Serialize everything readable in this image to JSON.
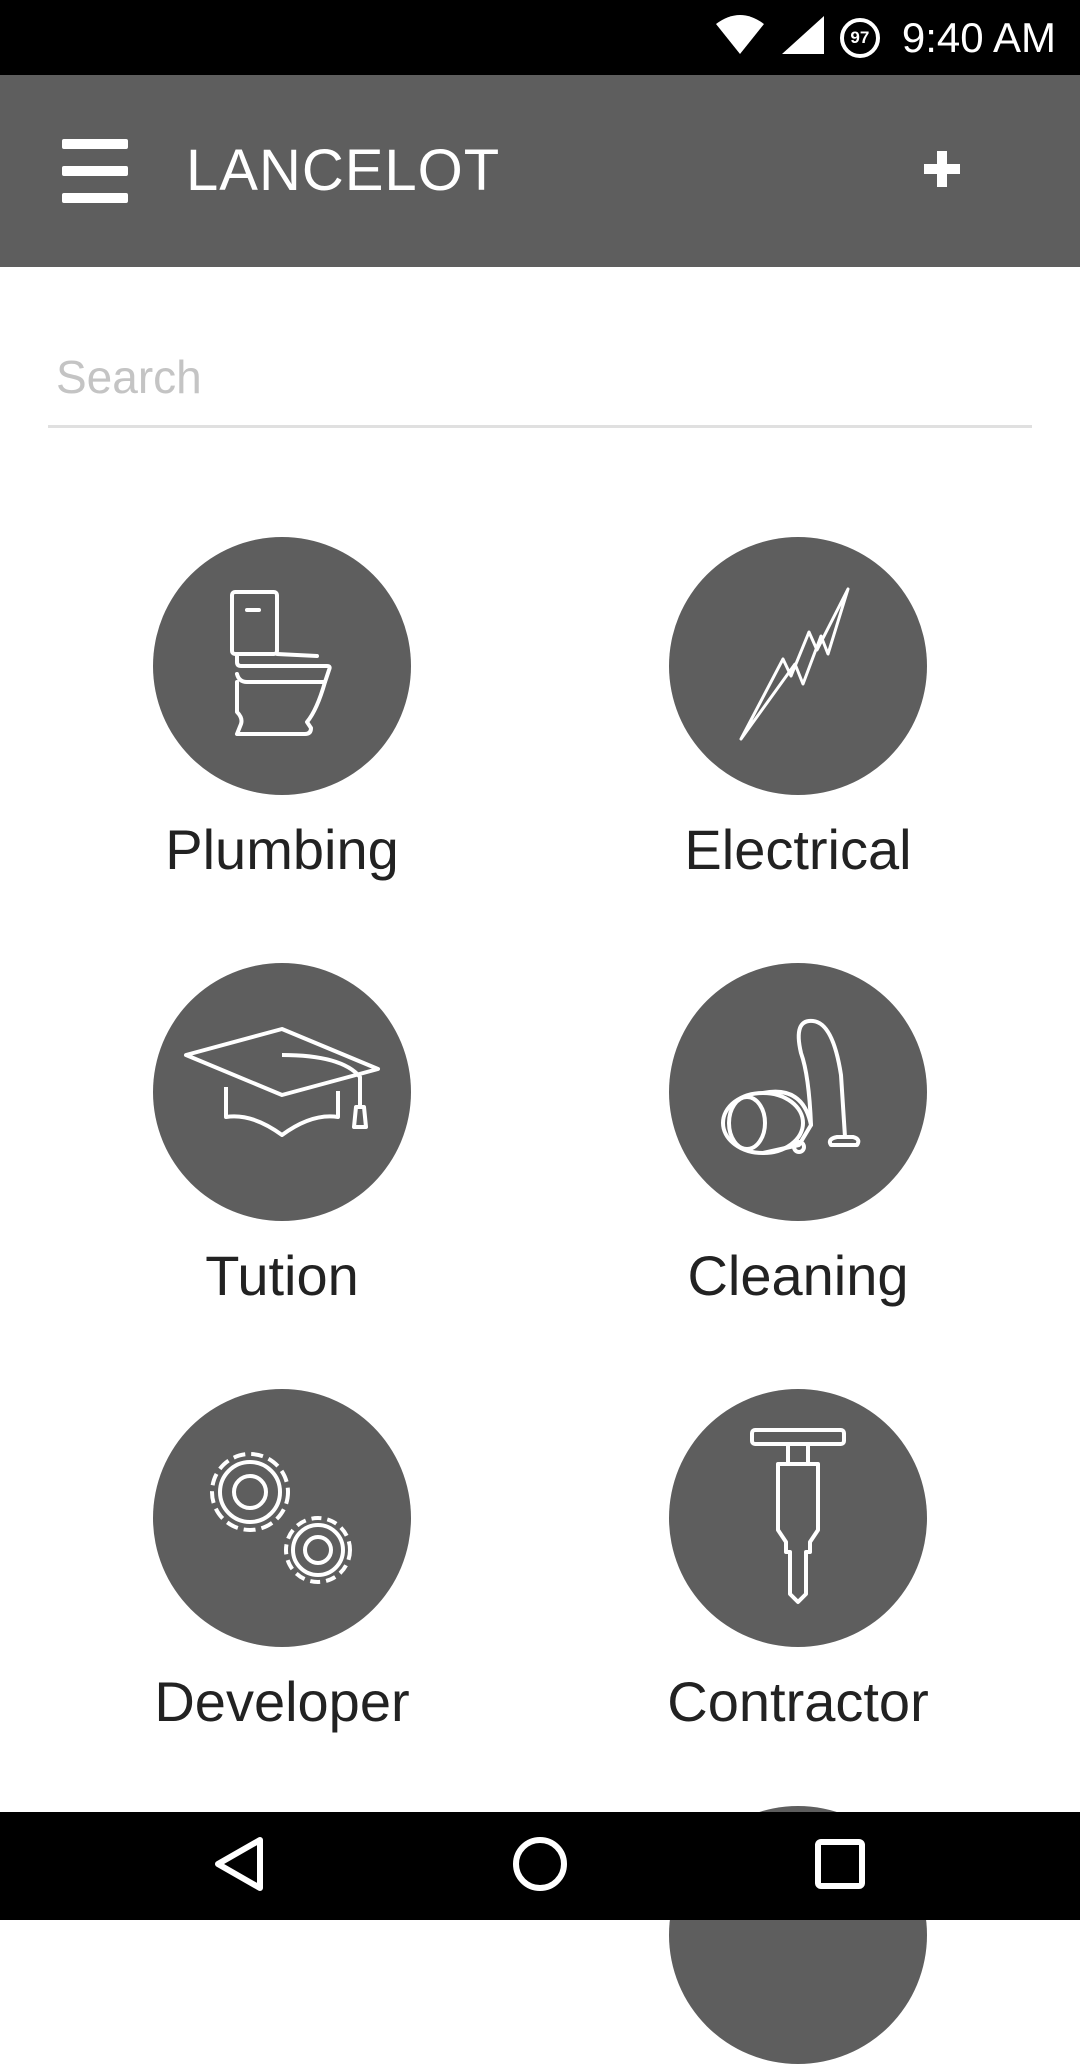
{
  "status_bar": {
    "time": "9:40 AM",
    "battery_level": "97",
    "icons": [
      "wifi-icon",
      "cellular-signal-icon",
      "battery-icon"
    ]
  },
  "app_bar": {
    "title": "LANCELOT",
    "menu_icon": "hamburger-menu-icon",
    "add_icon": "plus-icon"
  },
  "search": {
    "placeholder": "Search",
    "value": ""
  },
  "categories": [
    {
      "label": "Plumbing",
      "icon": "toilet-icon"
    },
    {
      "label": "Electrical",
      "icon": "lightning-bolt-icon"
    },
    {
      "label": "Tution",
      "icon": "graduation-cap-icon"
    },
    {
      "label": "Cleaning",
      "icon": "vacuum-cleaner-icon"
    },
    {
      "label": "Developer",
      "icon": "gears-icon"
    },
    {
      "label": "Contractor",
      "icon": "jackhammer-icon"
    }
  ],
  "nav_bar": {
    "icons": [
      "back-icon",
      "home-icon",
      "recents-icon"
    ]
  },
  "colors": {
    "app_bar": "#5e5e5e",
    "tile_circle": "#5e5e5e",
    "status_bar": "#000000",
    "nav_bar": "#000000"
  }
}
